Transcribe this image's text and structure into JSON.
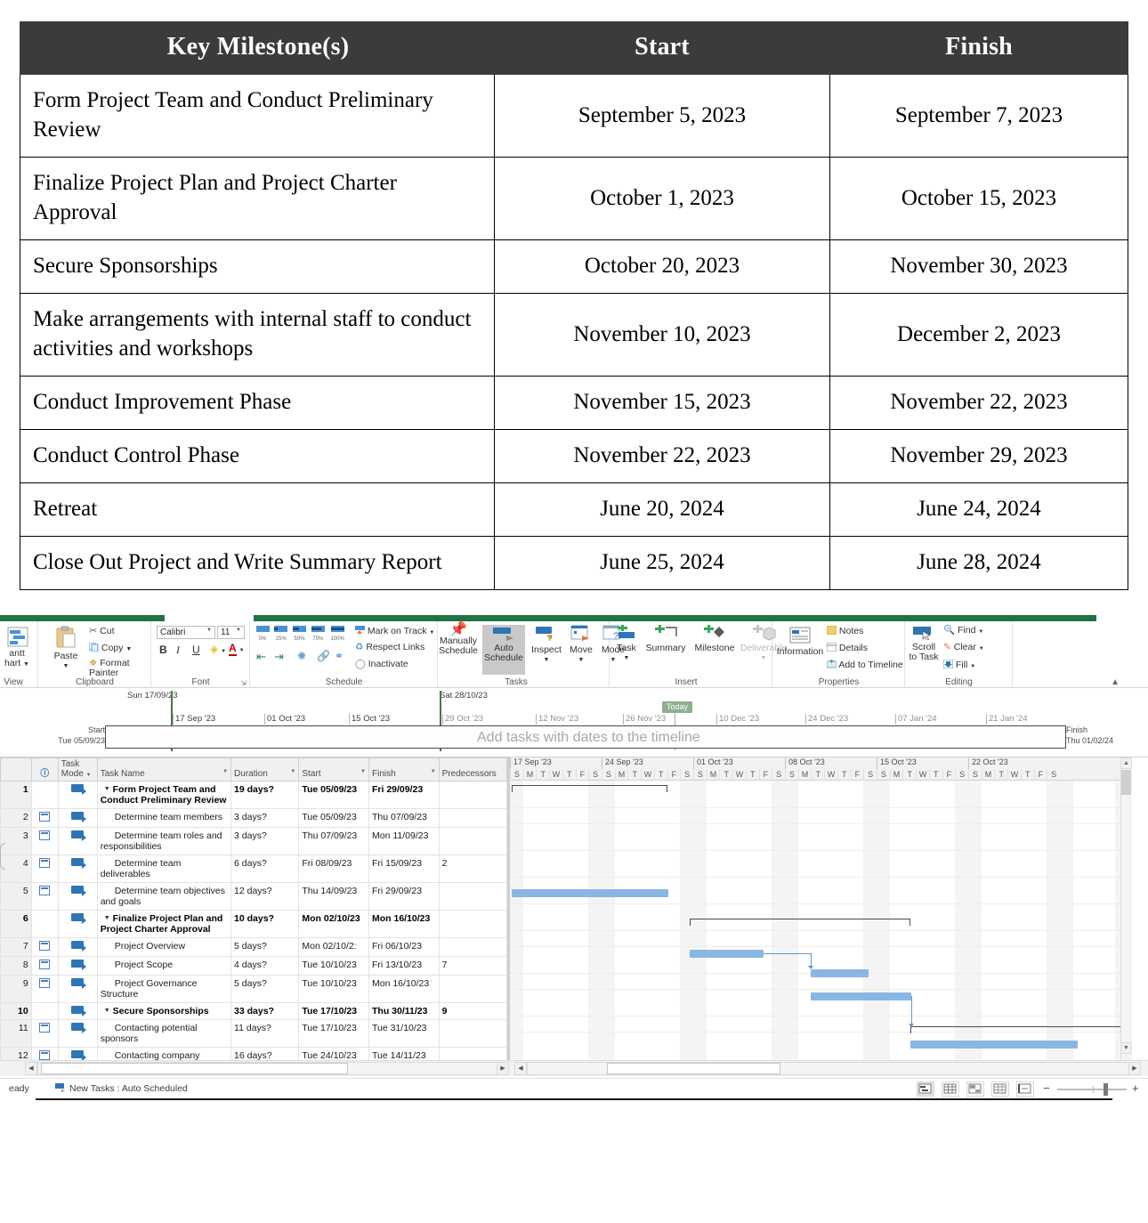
{
  "milestone_table": {
    "columns": [
      "Key Milestone(s)",
      "Start",
      "Finish"
    ],
    "rows": [
      {
        "name": "Form Project Team and Conduct Preliminary Review",
        "start": "September 5, 2023",
        "finish": "September 7, 2023"
      },
      {
        "name": "Finalize Project Plan and Project Charter Approval",
        "start": "October 1, 2023",
        "finish": "October 15, 2023"
      },
      {
        "name": "Secure Sponsorships",
        "start": "October 20, 2023",
        "finish": "November 30, 2023"
      },
      {
        "name": "Make arrangements with internal staff to conduct activities and workshops",
        "start": "November 10, 2023",
        "finish": "December 2, 2023"
      },
      {
        "name": "Conduct Improvement Phase",
        "start": "November 15, 2023",
        "finish": "November 22, 2023"
      },
      {
        "name": "Conduct Control Phase",
        "start": "November 22, 2023",
        "finish": "November 29, 2023"
      },
      {
        "name": "Retreat",
        "start": "June 20, 2024",
        "finish": "June 24, 2024"
      },
      {
        "name": "Close Out Project and Write Summary Report",
        "start": "June 25, 2024",
        "finish": "June 28, 2024"
      }
    ]
  },
  "project_app": {
    "accent_green": "#217346",
    "bar_blue": "#88b7e3",
    "ribbon": {
      "groups": [
        {
          "name": "View",
          "label": "View"
        },
        {
          "name": "Clipboard",
          "label": "Clipboard"
        },
        {
          "name": "Font",
          "label": "Font"
        },
        {
          "name": "Schedule",
          "label": "Schedule"
        },
        {
          "name": "Tasks",
          "label": "Tasks"
        },
        {
          "name": "Insert",
          "label": "Insert"
        },
        {
          "name": "Properties",
          "label": "Properties"
        },
        {
          "name": "Editing",
          "label": "Editing"
        }
      ],
      "view": {
        "line1": "antt",
        "line2": "hart"
      },
      "clipboard": {
        "paste": "Paste",
        "cut": "Cut",
        "copy": "Copy",
        "format_painter": "Format Painter"
      },
      "font": {
        "family_value": "Calibri",
        "size_value": "11",
        "bold": "B",
        "italic": "I",
        "underline": "U"
      },
      "schedule": {
        "pct": [
          "0%",
          "25%",
          "50%",
          "75%",
          "100%"
        ],
        "mark_on_track": "Mark on Track",
        "respect_links": "Respect Links",
        "inactivate": "Inactivate"
      },
      "tasks": {
        "manually_schedule": [
          "Manually",
          "Schedule"
        ],
        "auto_schedule": [
          "Auto",
          "Schedule"
        ],
        "inspect": "Inspect",
        "move": "Move",
        "mode": "Mode"
      },
      "insert": {
        "task": "Task",
        "summary": "Summary",
        "milestone": "Milestone",
        "deliverable": "Deliverable"
      },
      "properties": {
        "information": "Information",
        "notes": "Notes",
        "details": "Details",
        "add_to_timeline": "Add to Timeline"
      },
      "editing": {
        "scroll_to_task": [
          "Scroll",
          "to Task"
        ],
        "find": "Find",
        "clear": "Clear",
        "fill": "Fill"
      }
    },
    "timeline": {
      "start_label": "Start",
      "start_date": "Tue 05/09/23",
      "finish_label": "Finish",
      "finish_date": "Thu 01/02/24",
      "placeholder": "Add tasks with dates to the timeline",
      "today_label": "Today",
      "marker_left": "Sun 17/09/23",
      "marker_right": "Sat 28/10/23",
      "ticks": [
        "17 Sep '23",
        "01 Oct '23",
        "15 Oct '23",
        "29 Oct '23",
        "12 Nov '23",
        "26 Nov '23",
        "10 Dec '23",
        "24 Dec '23",
        "07 Jan '24",
        "21 Jan '24"
      ]
    },
    "grid": {
      "headers": {
        "info": "i",
        "task_mode_l1": "Task",
        "task_mode_l2": "Mode",
        "task_name": "Task Name",
        "duration": "Duration",
        "start": "Start",
        "finish": "Finish",
        "predecessors": "Predecessors"
      },
      "rows": [
        {
          "num": "1",
          "indicator": false,
          "summary": true,
          "name": "Form Project Team and Conduct Preliminary Review",
          "duration": "19 days?",
          "start": "Tue 05/09/23",
          "finish": "Fri 29/09/23",
          "pred": ""
        },
        {
          "num": "2",
          "indicator": true,
          "summary": false,
          "name": "Determine team members",
          "duration": "3 days?",
          "start": "Tue 05/09/23",
          "finish": "Thu 07/09/23",
          "pred": ""
        },
        {
          "num": "3",
          "indicator": true,
          "summary": false,
          "name": "Determine team roles and responsibilities",
          "duration": "3 days?",
          "start": "Thu 07/09/23",
          "finish": "Mon 11/09/23",
          "pred": ""
        },
        {
          "num": "4",
          "indicator": true,
          "summary": false,
          "name": "Determine team deliverables",
          "duration": "6 days?",
          "start": "Fri 08/09/23",
          "finish": "Fri 15/09/23",
          "pred": "2"
        },
        {
          "num": "5",
          "indicator": true,
          "summary": false,
          "name": "Determine team objectives and goals",
          "duration": "12 days?",
          "start": "Thu 14/09/23",
          "finish": "Fri 29/09/23",
          "pred": ""
        },
        {
          "num": "6",
          "indicator": false,
          "summary": true,
          "name": "Finalize Project Plan and Project Charter Approval",
          "duration": "10 days?",
          "start": "Mon 02/10/23",
          "finish": "Mon 16/10/23",
          "pred": ""
        },
        {
          "num": "7",
          "indicator": true,
          "summary": false,
          "name": "Project Overview",
          "duration": "5 days?",
          "start": "Mon 02/10/2:",
          "finish": "Fri 06/10/23",
          "pred": ""
        },
        {
          "num": "8",
          "indicator": true,
          "summary": false,
          "name": "Project Scope",
          "duration": "4 days?",
          "start": "Tue 10/10/23",
          "finish": "Fri 13/10/23",
          "pred": "7"
        },
        {
          "num": "9",
          "indicator": true,
          "summary": false,
          "name": "Project Governance Structure",
          "duration": "5 days?",
          "start": "Tue 10/10/23",
          "finish": "Mon 16/10/23",
          "pred": ""
        },
        {
          "num": "10",
          "indicator": false,
          "summary": true,
          "name": "Secure Sponsorships",
          "duration": "33 days?",
          "start": "Tue 17/10/23",
          "finish": "Thu 30/11/23",
          "pred": "9"
        },
        {
          "num": "11",
          "indicator": true,
          "summary": false,
          "name": "Contacting potential sponsors",
          "duration": "11 days?",
          "start": "Tue 17/10/23",
          "finish": "Tue 31/10/23",
          "pred": ""
        },
        {
          "num": "12",
          "indicator": true,
          "summary": false,
          "name": "Contacting company clients",
          "duration": "16 days?",
          "start": "Tue 24/10/23",
          "finish": "Tue 14/11/23",
          "pred": ""
        }
      ]
    },
    "gantt": {
      "weeks": [
        "17 Sep '23",
        "24 Sep '23",
        "01 Oct '23",
        "08 Oct '23",
        "15 Oct '23",
        "22 Oct '23"
      ],
      "days": [
        "S",
        "M",
        "T",
        "W",
        "T",
        "F",
        "S"
      ]
    },
    "status": {
      "ready": "eady",
      "new_tasks": "New Tasks : Auto Scheduled"
    }
  }
}
